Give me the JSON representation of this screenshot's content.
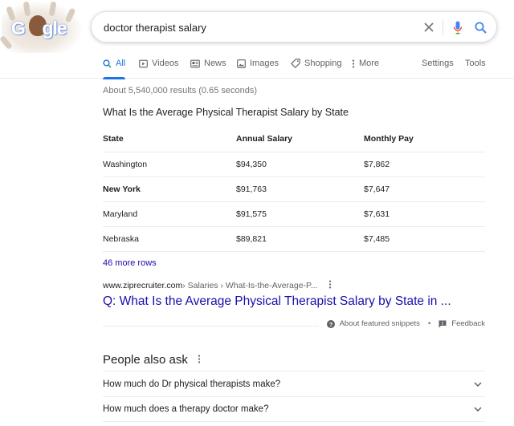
{
  "search": {
    "query": "doctor therapist salary"
  },
  "tabs": [
    {
      "label": "All",
      "icon": "search-icon"
    },
    {
      "label": "Videos",
      "icon": "video-icon"
    },
    {
      "label": "News",
      "icon": "news-icon"
    },
    {
      "label": "Images",
      "icon": "image-icon"
    },
    {
      "label": "Shopping",
      "icon": "tag-icon"
    },
    {
      "label": "More",
      "icon": "more-vert-icon"
    }
  ],
  "tools": {
    "settings": "Settings",
    "tools": "Tools"
  },
  "stats": "About 5,540,000 results (0.65 seconds)",
  "snippet": {
    "title": "What Is the Average Physical Therapist Salary by State",
    "columns": [
      "State",
      "Annual Salary",
      "Monthly Pay"
    ],
    "rows": [
      [
        "Washington",
        "$94,350",
        "$7,862"
      ],
      [
        "New York",
        "$91,763",
        "$7,647"
      ],
      [
        "Maryland",
        "$91,575",
        "$7,631"
      ],
      [
        "Nebraska",
        "$89,821",
        "$7,485"
      ]
    ],
    "more_rows": "46 more rows"
  },
  "result": {
    "domain": "www.ziprecruiter.com",
    "path": " › Salaries › What-Is-the-Average-P...",
    "title": "Q: What Is the Average Physical Therapist Salary by State in ..."
  },
  "featured": {
    "about": "About featured snippets",
    "separator": "•",
    "feedback": "Feedback"
  },
  "people_also_ask": {
    "heading": "People also ask",
    "questions": [
      "How much do Dr physical therapists make?",
      "How much does a therapy doctor make?"
    ]
  },
  "colors": {
    "link": "#1a0dab",
    "accent": "#1a73e8",
    "muted": "#5f6368"
  }
}
